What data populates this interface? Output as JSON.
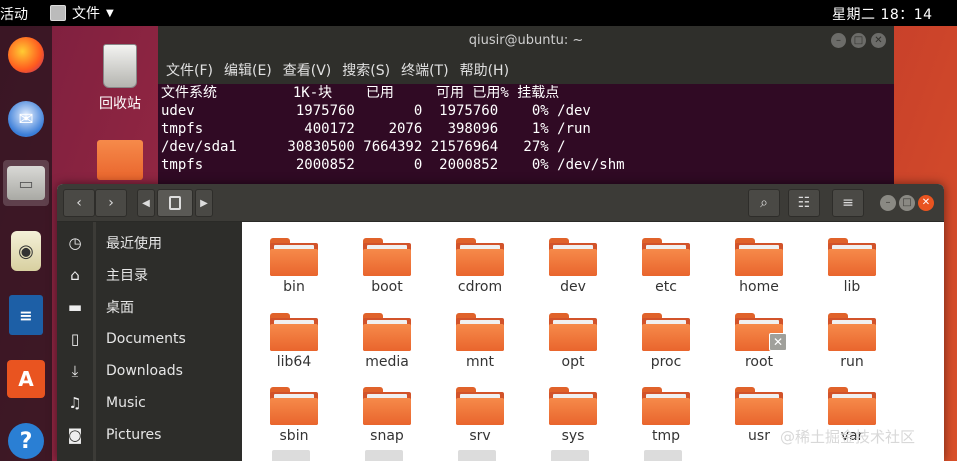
{
  "topbar": {
    "activities": "活动",
    "app_menu": "文件",
    "clock": "星期二 18：14"
  },
  "desktop": {
    "trash_label": "回收站"
  },
  "terminal": {
    "title": "qiusir@ubuntu: ~",
    "menu": [
      "文件(F)",
      "编辑(E)",
      "查看(V)",
      "搜索(S)",
      "终端(T)",
      "帮助(H)"
    ],
    "df_header": "文件系统         1K-块    已用     可用 已用% 挂载点",
    "df_rows": [
      "udev            1975760       0  1975760    0% /dev",
      "tmpfs            400172    2076   398096    1% /run",
      "/dev/sda1      30830500 7664392 21576964   27% /",
      "tmpfs           2000852       0  2000852    0% /dev/shm"
    ]
  },
  "files": {
    "sidebar": [
      {
        "icon": "clock-icon",
        "label": "最近使用"
      },
      {
        "icon": "home-icon",
        "label": "主目录"
      },
      {
        "icon": "folder-icon",
        "label": "桌面"
      },
      {
        "icon": "document-icon",
        "label": "Documents"
      },
      {
        "icon": "download-icon",
        "label": "Downloads"
      },
      {
        "icon": "music-icon",
        "label": "Music"
      },
      {
        "icon": "camera-icon",
        "label": "Pictures"
      }
    ],
    "folders": [
      "bin",
      "boot",
      "cdrom",
      "dev",
      "etc",
      "home",
      "lib",
      "lib64",
      "media",
      "mnt",
      "opt",
      "proc",
      "root",
      "run",
      "sbin",
      "snap",
      "srv",
      "sys",
      "tmp",
      "usr",
      "var"
    ],
    "locked_folder": "root"
  },
  "watermark": "@稀土掘金技术社区",
  "colors": {
    "folder_orange": "#f07a3a",
    "terminal_bg": "#300a24",
    "close_button": "#e95420"
  }
}
